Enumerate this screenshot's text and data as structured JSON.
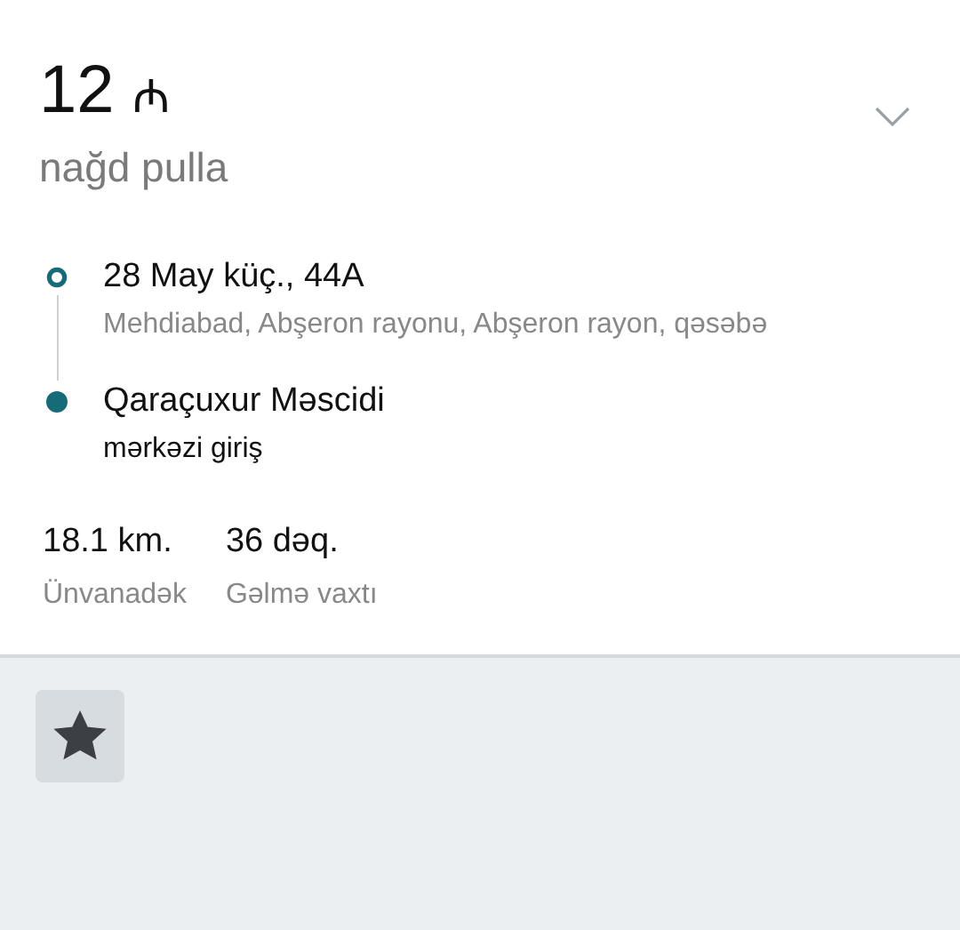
{
  "fare": {
    "amount": "12",
    "currency": "₼",
    "payment": "nağd pulla"
  },
  "route": [
    {
      "kind": "origin",
      "title": "28 May küç., 44A",
      "detail": "Mehdiabad, Abşeron rayonu, Abşeron rayon, qəsəbə"
    },
    {
      "kind": "destination",
      "title": "Qaraçuxur Məscidi",
      "detail": "mərkəzi giriş"
    }
  ],
  "stats": [
    {
      "value": "18.1 km.",
      "label": "Ünvanadək"
    },
    {
      "value": "36 dəq.",
      "label": "Gəlmə vaxtı"
    }
  ],
  "favorite": {
    "on": true
  }
}
